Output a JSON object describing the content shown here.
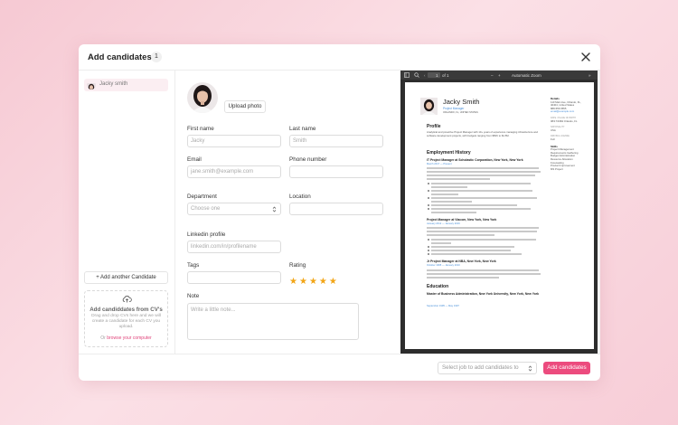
{
  "modal": {
    "title": "Add candidates",
    "count": "1"
  },
  "sidebar": {
    "candidates": [
      {
        "name": "Jacky smith"
      }
    ],
    "add_another": "+ Add another Candidate",
    "dropzone": {
      "title": "Add candiddates from CV's",
      "description": "Drag and drop CVs here and we will create a candidate for each CV you upload.",
      "or": "Or",
      "browse": "browse your computer"
    }
  },
  "form": {
    "upload_photo": "Upload photo",
    "first_name": {
      "label": "First name",
      "placeholder": "Jacky"
    },
    "last_name": {
      "label": "Last name",
      "placeholder": "Smith"
    },
    "email": {
      "label": "Email",
      "placeholder": "jane.smith@example.com"
    },
    "phone": {
      "label": "Phone number",
      "placeholder": ""
    },
    "department": {
      "label": "Department",
      "placeholder": "Choose one"
    },
    "location": {
      "label": "Location",
      "placeholder": ""
    },
    "linkedin": {
      "label": "Linkedin profile",
      "placeholder": "linkedin.com/in/profilename"
    },
    "tags": {
      "label": "Tags",
      "placeholder": ""
    },
    "rating": {
      "label": "Rating",
      "value": 5,
      "max": 5
    },
    "note": {
      "label": "Note",
      "placeholder": "Write a little note..."
    }
  },
  "pdf": {
    "toolbar": {
      "page": "1",
      "of": "of 1",
      "zoom": "Automatic Zoom"
    },
    "cv": {
      "name": "Jacky Smith",
      "role": "Project Manager",
      "location": "ORLANDO, FL, UNITED STATES",
      "details_title": "Details",
      "details": "110 Main Ave, Orlando, FL, 40404, United States",
      "phone": "888-555-5555",
      "email": "email@example.com",
      "dob_label": "DATE / PLACE OF BIRTH",
      "dob": "08/17/1984 Orlando, FL",
      "nationality_label": "NATIONALITY",
      "nationality": "USA",
      "license_label": "DRIVING LICENSE",
      "license": "Full",
      "skills_title": "Skills",
      "skills": [
        "Project Management",
        "Requirements Gathering",
        "Budget Administration",
        "Resource Allocation",
        "Forecasting",
        "Product Improvement",
        "MS Project"
      ],
      "profile_title": "Profile",
      "profile": "Analytical and proactive Project Manager with 10+ years of experience managing infrastructure and software development projects, with budgets ranging from $50K to $1.5M.",
      "employment_title": "Employment History",
      "jobs": [
        {
          "title": "IT Project Manager at Scholastic Corporation, New York, New York",
          "date": "March 2017 — Present"
        },
        {
          "title": "Project Manager at Viacom, New York, New York",
          "date": "January 2012 — January 2016"
        },
        {
          "title": "Jr Project Manager at NBA, New York, New York",
          "date": "October 1995 — January 2010"
        }
      ],
      "education_title": "Education",
      "education": "Master of Business Administration, New York University, New York, New York",
      "education_date": "September 1995 — May 1997"
    }
  },
  "footer": {
    "job_select_placeholder": "Select job to add candidates to",
    "add_button": "Add candidates"
  },
  "colors": {
    "accent": "#ec4b7e",
    "star": "#f2a516",
    "link": "#4a90d9"
  }
}
